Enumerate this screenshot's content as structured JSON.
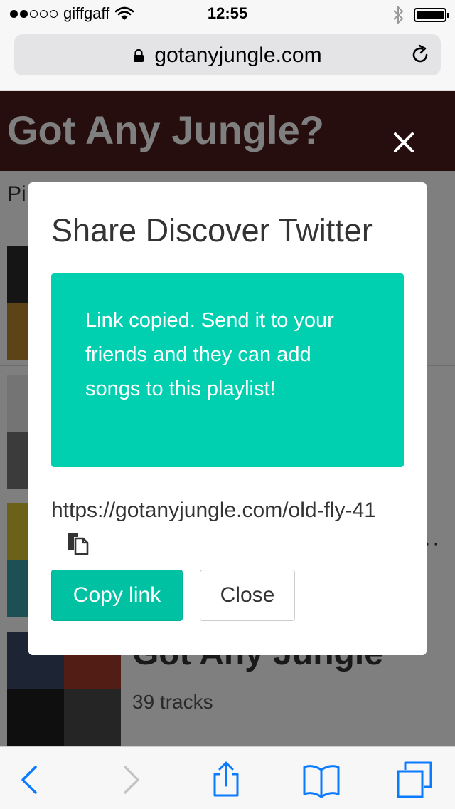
{
  "status_bar": {
    "carrier": "giffgaff",
    "time": "12:55"
  },
  "browser": {
    "url": "gotanyjungle.com"
  },
  "page": {
    "site_title": "Got Any Jungle?",
    "subtitle": "Pi",
    "playlists": [
      {
        "title": "",
        "subtitle": ""
      },
      {
        "title": "",
        "subtitle": ""
      },
      {
        "title": "",
        "subtitle": ""
      },
      {
        "title": "Got Any Jungle",
        "subtitle": "39 tracks"
      }
    ],
    "more_glyph": "···"
  },
  "modal": {
    "title": "Share Discover Twitter",
    "alert_text": "Link copied. Send it to your friends and they can add songs to this playlist!",
    "share_url": "https://gotanyjungle.com/old-fly-41",
    "copy_button": "Copy link",
    "close_button": "Close"
  },
  "colors": {
    "accent": "#00cfb0",
    "primary_button": "#00c2a3",
    "header_bg": "#4f1d1d",
    "ios_blue": "#0a7aff"
  },
  "icons": {
    "wifi": "wifi-icon",
    "bluetooth": "bluetooth-icon",
    "battery": "battery-icon",
    "lock": "lock-icon",
    "reload": "reload-icon",
    "overlay_close": "close-icon",
    "copy": "copy-icon",
    "back": "back-icon",
    "forward": "forward-icon",
    "share": "share-icon",
    "bookmarks": "bookmarks-icon",
    "tabs": "tabs-icon"
  }
}
